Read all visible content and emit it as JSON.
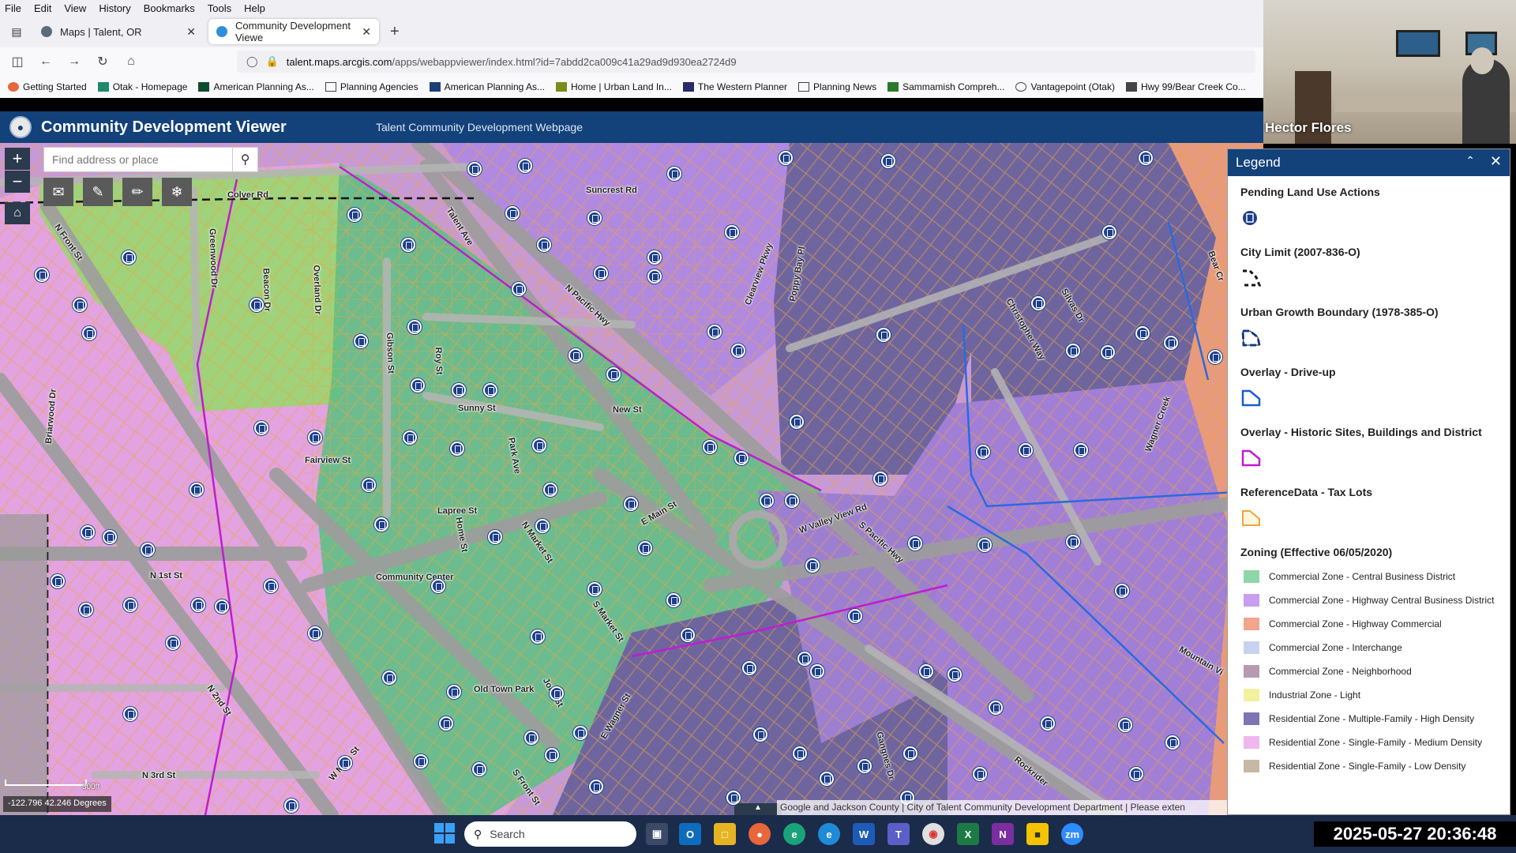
{
  "browser": {
    "menu": [
      "File",
      "Edit",
      "View",
      "History",
      "Bookmarks",
      "Tools",
      "Help"
    ],
    "tabs": [
      {
        "title": "Maps | Talent, OR",
        "active": false
      },
      {
        "title": "Community Development Viewe",
        "active": true
      }
    ],
    "url": {
      "host": "talent.maps.arcgis.com",
      "path": "/apps/webappviewer/index.html?id=7abdd2ca009c41a29ad9d930ea2724d9"
    },
    "bookmarks": [
      "Getting Started",
      "Otak - Homepage",
      "American Planning As...",
      "Planning Agencies",
      "American Planning As...",
      "Home | Urban Land In...",
      "The Western Planner",
      "Planning News",
      "Sammamish Compreh...",
      "Vantagepoint (Otak)",
      "Hwy 99/Bear Creek Co..."
    ]
  },
  "video": {
    "participant": "Hector Flores"
  },
  "app": {
    "title": "Community Development Viewer",
    "subtitle": "Talent Community Development Webpage"
  },
  "map": {
    "search_placeholder": "Find address or place",
    "coordinates": "-122.796 42.246 Degrees",
    "scale_label": "300ft",
    "attribution": "Google and Jackson County | City of Talent Community Development Department | Please exten",
    "road_labels": [
      "Colver Rd",
      "Suncrest Rd",
      "Talent Ave",
      "N Pacific Hwy",
      "Clearview Pkwy",
      "Poppy Bay Pl",
      "N Front St",
      "Greenwood Dr",
      "Beacon Dr",
      "Overland Dr",
      "Gibson St",
      "Roy St",
      "Sunny St",
      "New St",
      "Fairview St",
      "Park Ave",
      "Lapree St",
      "E Main St",
      "W Valley View Rd",
      "S Pacific Hwy",
      "Christopher Way",
      "Silvas Dr",
      "Wagner Creek",
      "N 1st St",
      "N 2nd St",
      "N 3rd St",
      "John St",
      "Old Town Park",
      "Community Center",
      "E Wagner St",
      "S Market St",
      "W Main St",
      "S Front St",
      "Rockrider",
      "Briarwood Dr",
      "Home St",
      "N Market St",
      "Gangnes Dr",
      "Mountain Vi",
      "Bear Cr"
    ]
  },
  "legend": {
    "title": "Legend",
    "layers": [
      {
        "title": "Pending Land Use Actions",
        "symbol": "pin"
      },
      {
        "title": "City Limit (2007-836-O)",
        "symbol": "dash-black"
      },
      {
        "title": "Urban Growth Boundary (1978-385-O)",
        "symbol": "dash-blue"
      },
      {
        "title": "Overlay - Drive-up",
        "symbol": "outline-blue"
      },
      {
        "title": "Overlay - Historic Sites, Buildings and District",
        "symbol": "outline-magenta"
      },
      {
        "title": "ReferenceData - Tax Lots",
        "symbol": "outline-orange"
      }
    ],
    "zoning_title": "Zoning (Effective 06/05/2020)",
    "zones": [
      {
        "label": "Commercial Zone - Central Business District",
        "color": "#8fd6a8"
      },
      {
        "label": "Commercial Zone - Highway Central Business District",
        "color": "#c79ef0"
      },
      {
        "label": "Commercial Zone - Highway Commercial",
        "color": "#f3a48c"
      },
      {
        "label": "Commercial Zone - Interchange",
        "color": "#c7d3ee"
      },
      {
        "label": "Commercial Zone - Neighborhood",
        "color": "#b79ab2"
      },
      {
        "label": "Industrial Zone - Light",
        "color": "#f3f0a0"
      },
      {
        "label": "Residential Zone - Multiple-Family - High Density",
        "color": "#7d75b5"
      },
      {
        "label": "Residential Zone - Single-Family - Medium Density",
        "color": "#f0b7ec"
      },
      {
        "label": "Residential Zone - Single-Family - Low Density",
        "color": "#c6b8a4"
      }
    ]
  },
  "taskbar": {
    "search_placeholder": "Search",
    "apps": [
      "Task View",
      "Outlook",
      "File Explorer",
      "Firefox",
      "Edge Dev",
      "Edge",
      "Word",
      "Teams",
      "Chrome",
      "Excel",
      "OneNote",
      "Sticky Notes",
      "Zoom"
    ],
    "clock": "2025-05-27  20:36:48"
  }
}
